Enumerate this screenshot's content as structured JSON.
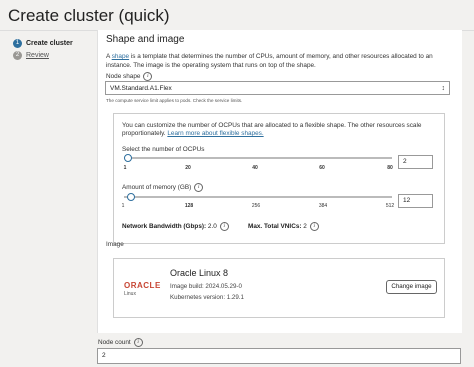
{
  "page_title": "Create cluster (quick)",
  "steps": [
    {
      "number": "1",
      "label": "Create cluster"
    },
    {
      "number": "2",
      "label": "Review"
    }
  ],
  "section": {
    "title": "Shape and image",
    "desc_before": "A ",
    "desc_link": "shape",
    "desc_after": " is a template that determines the number of CPUs, amount of memory, and other resources allocated to an instance. The image is the operating system that runs on top of the shape."
  },
  "node_shape": {
    "label": "Node shape",
    "value": "VM.Standard.A1.Flex",
    "hint": "The compute service limit applies to pods. Check the service limits."
  },
  "flex": {
    "desc": "You can customize the number of OCPUs that are allocated to a flexible shape. The other resources scale proportionately. ",
    "desc_link": "Learn more about flexible shapes.",
    "ocpu": {
      "label": "Select the number of OCPUs",
      "ticks": [
        "1",
        "20",
        "40",
        "60",
        "80"
      ],
      "value": "2",
      "slider_fraction": 0.013
    },
    "memory": {
      "label": "Amount of memory (GB)",
      "ticks": [
        "1",
        "128",
        "256",
        "384",
        "512"
      ],
      "value": "12",
      "slider_fraction": 0.021
    },
    "network_label": "Network Bandwidth (Gbps):",
    "network_value": "2.0",
    "vnics_label": "Max. Total VNICs:",
    "vnics_value": "2"
  },
  "image": {
    "label": "Image",
    "logo_text": "ORACLE",
    "logo_sub": "Linux",
    "name": "Oracle Linux 8",
    "build": "Image build: 2024.05.29-0",
    "k8s": "Kubernetes version: 1.29.1",
    "change_button": "Change image"
  },
  "node_count": {
    "label": "Node count",
    "value": "2"
  },
  "colors": {
    "accent": "#2e6f9e",
    "oracle_red": "#c74634",
    "background": "#f2f1ef"
  }
}
